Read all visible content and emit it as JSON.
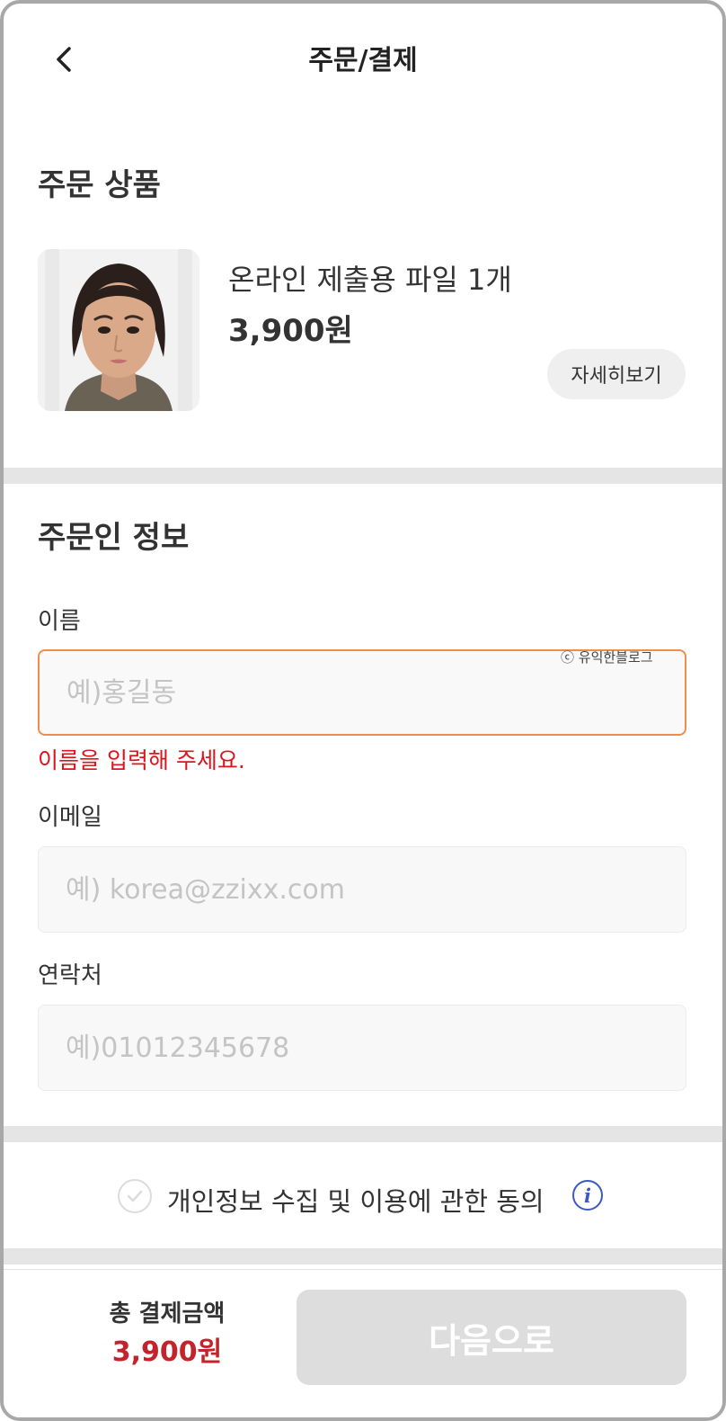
{
  "header": {
    "title": "주문/결제",
    "back_icon": "chevron-left-icon"
  },
  "order_product": {
    "section_title": "주문 상품",
    "image_icon": "passport-photo-portrait",
    "name": "온라인 제출용 파일 1개",
    "price": "3,900원",
    "detail_button": "자세히보기"
  },
  "orderer": {
    "section_title": "주문인 정보",
    "name": {
      "label": "이름",
      "value": "",
      "placeholder": "예)홍길동",
      "error": "이름을 입력해 주세요."
    },
    "email": {
      "label": "이메일",
      "value": "",
      "placeholder": "예) korea@zzixx.com"
    },
    "phone": {
      "label": "연락처",
      "value": "",
      "placeholder": "예)01012345678"
    },
    "watermark": "ⓒ 유익한블로그"
  },
  "consent": {
    "text": "개인정보 수집 및 이용에 관한 동의",
    "checked": false,
    "info_icon": "info-icon"
  },
  "footer": {
    "total_label": "총 결제금액",
    "total_amount": "3,900원",
    "next_button": "다음으로"
  },
  "colors": {
    "error_red": "#e0131c",
    "price_red": "#c3242b",
    "focus_orange": "#ef8e4c",
    "info_blue": "#3a59c2",
    "disabled_gray": "#dddddd"
  }
}
